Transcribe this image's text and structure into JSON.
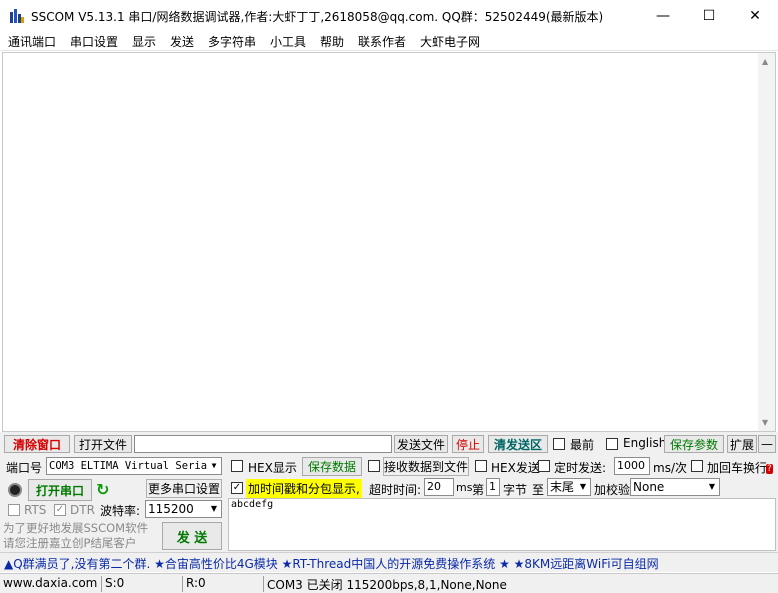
{
  "window": {
    "title": "SSCOM V5.13.1 串口/网络数据调试器,作者:大虾丁丁,2618058@qq.com. QQ群：52502449(最新版本)",
    "minimize": "—",
    "maximize": "☐",
    "close": "✕"
  },
  "menu": [
    "通讯端口",
    "串口设置",
    "显示",
    "发送",
    "多字符串",
    "小工具",
    "帮助",
    "联系作者",
    "大虾电子网"
  ],
  "toolbar": {
    "clear_window": "清除窗口",
    "open_file": "打开文件",
    "file_path": "",
    "send_file": "发送文件",
    "stop": "停止",
    "clear_send": "清发送区",
    "topmost": "最前",
    "english": "English",
    "save_params": "保存参数",
    "expand": "扩展",
    "collapse": "—"
  },
  "port": {
    "port_label": "端口号",
    "port_value": "COM3 ELTIMA Virtual Serial",
    "open_port": "打开串口",
    "more_settings": "更多串口设置",
    "rts": "RTS",
    "dtr": "DTR",
    "baud_label": "波特率:",
    "baud_value": "115200",
    "promo_line1": "为了更好地发展SSCOM软件",
    "promo_line2": "请您注册嘉立创P结尾客户",
    "send": "发  送"
  },
  "options": {
    "hex_display": "HEX显示",
    "save_data": "保存数据",
    "recv_to_file": "接收数据到文件",
    "hex_send": "HEX发送",
    "timed_send": "定时发送:",
    "timed_value": "1000",
    "timed_unit": "ms/次",
    "add_crlf": "加回车换行",
    "timestamp": "加时间戳和分包显示,",
    "timeout_label": "超时时间:",
    "timeout_value": "20",
    "timeout_unit": "ms",
    "nth_label": "第",
    "nth_value": "1",
    "byte_label": "字节",
    "to_label": "至",
    "end_value": "末尾",
    "checksum_label": "加校验",
    "checksum_value": "None"
  },
  "send_text": "abcdefg",
  "ticker": "▲Q群满员了,没有第二个群. ★合宙高性价比4G模块 ★RT-Thread中国人的开源免费操作系统 ★ ★8KM远距离WiFi可自组网",
  "status": {
    "website": "www.daxia.com",
    "sent": "S:0",
    "received": "R:0",
    "port_state": "COM3 已关闭  115200bps,8,1,None,None"
  }
}
